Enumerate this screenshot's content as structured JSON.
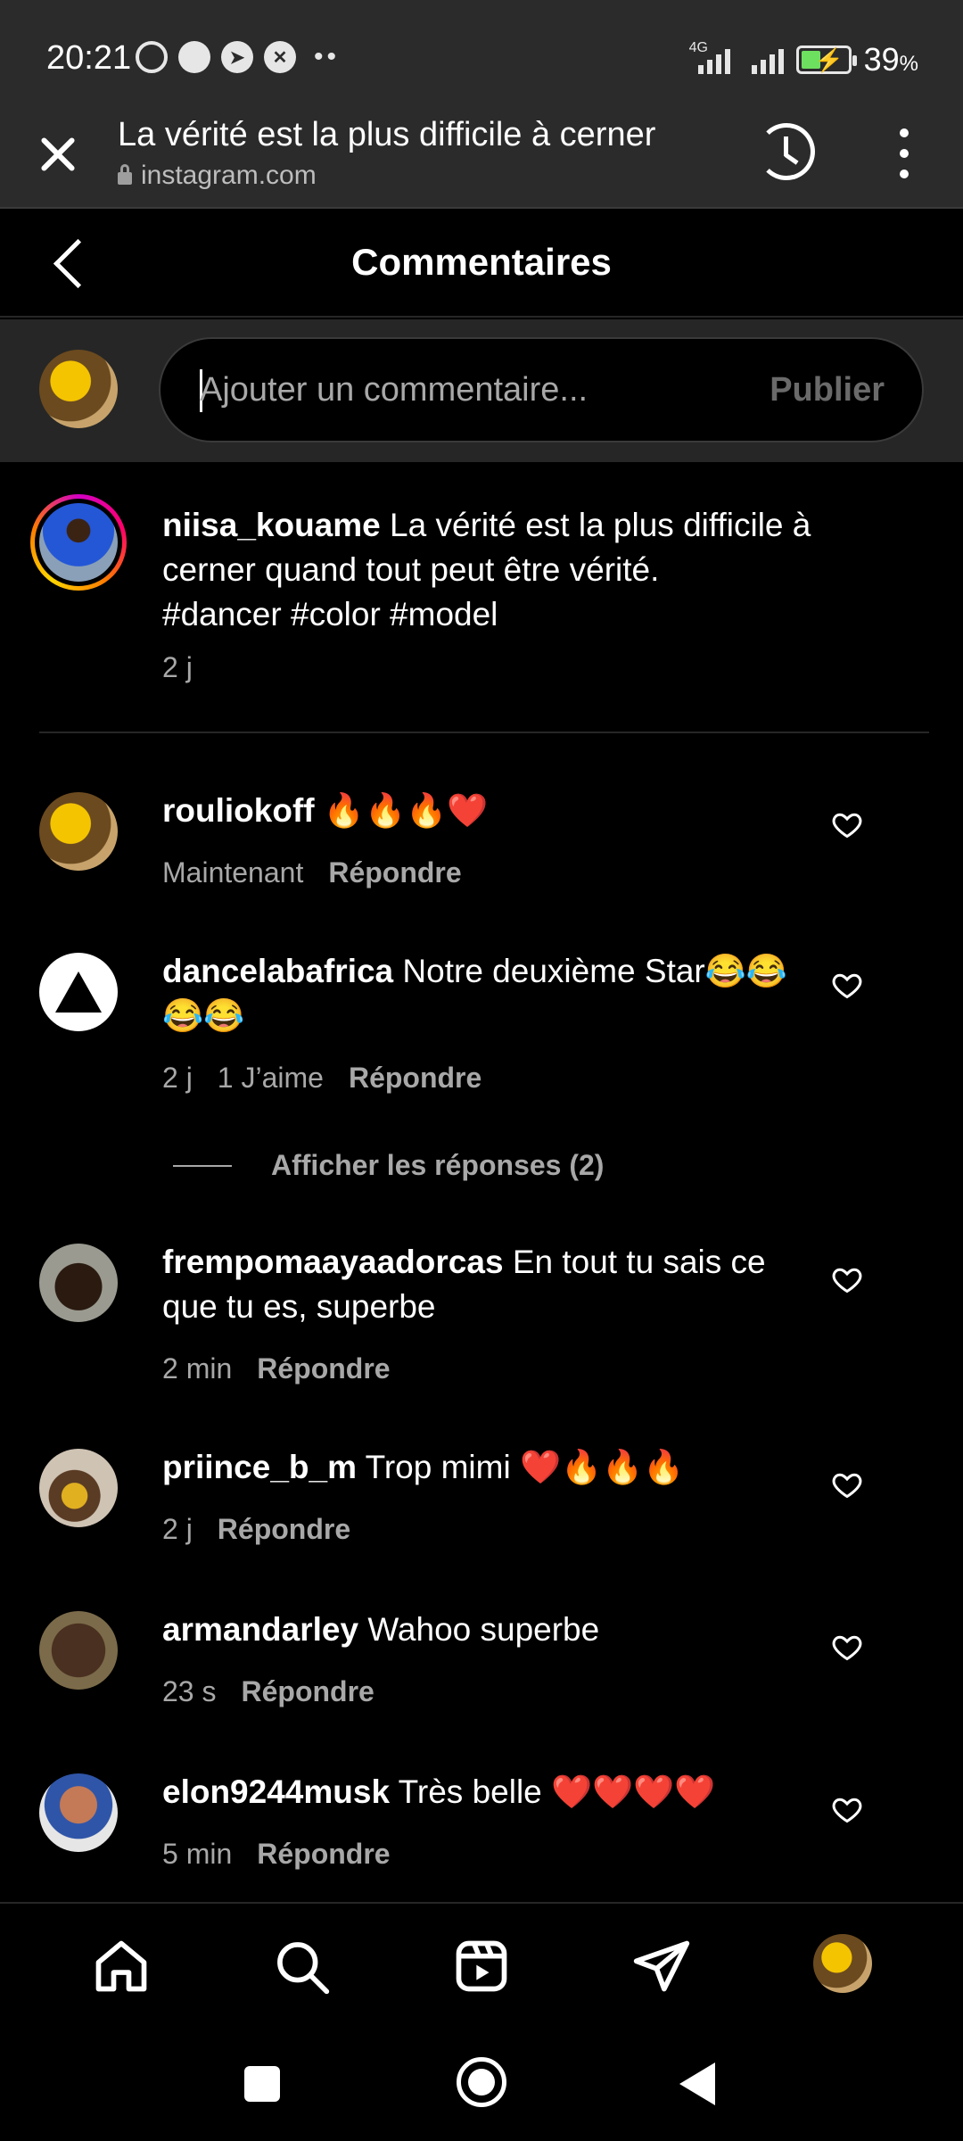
{
  "status_bar": {
    "time": "20:21",
    "network": "4G",
    "battery_percent": "39",
    "battery_unit": "%",
    "battery_level": 0.39,
    "icons": [
      "alarm-icon",
      "chat-icon",
      "telegram-icon",
      "app-icon"
    ]
  },
  "browser": {
    "page_title": "La vérité est la plus difficile à cerner",
    "url": "instagram.com"
  },
  "header": {
    "title": "Commentaires"
  },
  "composer": {
    "placeholder": "Ajouter un commentaire...",
    "publish_label": "Publier"
  },
  "post": {
    "username": "niisa_kouame",
    "caption": "La vérité est la plus difficile à cerner quand tout peut être vérité.",
    "hashtags": "#dancer #color #model",
    "time": "2 j"
  },
  "comments": [
    {
      "username": "rouliokoff",
      "text": "🔥🔥🔥❤️",
      "time": "Maintenant",
      "likes": "",
      "reply": "Répondre"
    },
    {
      "username": "dancelabafrica",
      "text": "Notre deuxième Star😂😂😂😂",
      "time": "2 j",
      "likes": "1 J’aime",
      "reply": "Répondre"
    },
    {
      "username": "frempomaayaadorcas",
      "text": "En tout tu sais ce que tu es, superbe",
      "time": "2 min",
      "likes": "",
      "reply": "Répondre"
    },
    {
      "username": "priince_b_m",
      "text": "Trop mimi ❤️🔥🔥🔥",
      "time": "2 j",
      "likes": "",
      "reply": "Répondre"
    },
    {
      "username": "armandarley",
      "text": "Wahoo superbe",
      "time": "23 s",
      "likes": "",
      "reply": "Répondre"
    },
    {
      "username": "elon9244musk",
      "text": "Très belle ❤️❤️❤️❤️",
      "time": "5 min",
      "likes": "",
      "reply": "Répondre"
    }
  ],
  "show_replies": "Afficher les réponses (2)",
  "nav": [
    "home-icon",
    "search-icon",
    "reels-icon",
    "direct-icon",
    "profile-avatar"
  ],
  "colors": {
    "background": "#000000",
    "secondary_text": "#a8a8a8",
    "browser_bar": "#2b2b2b"
  }
}
